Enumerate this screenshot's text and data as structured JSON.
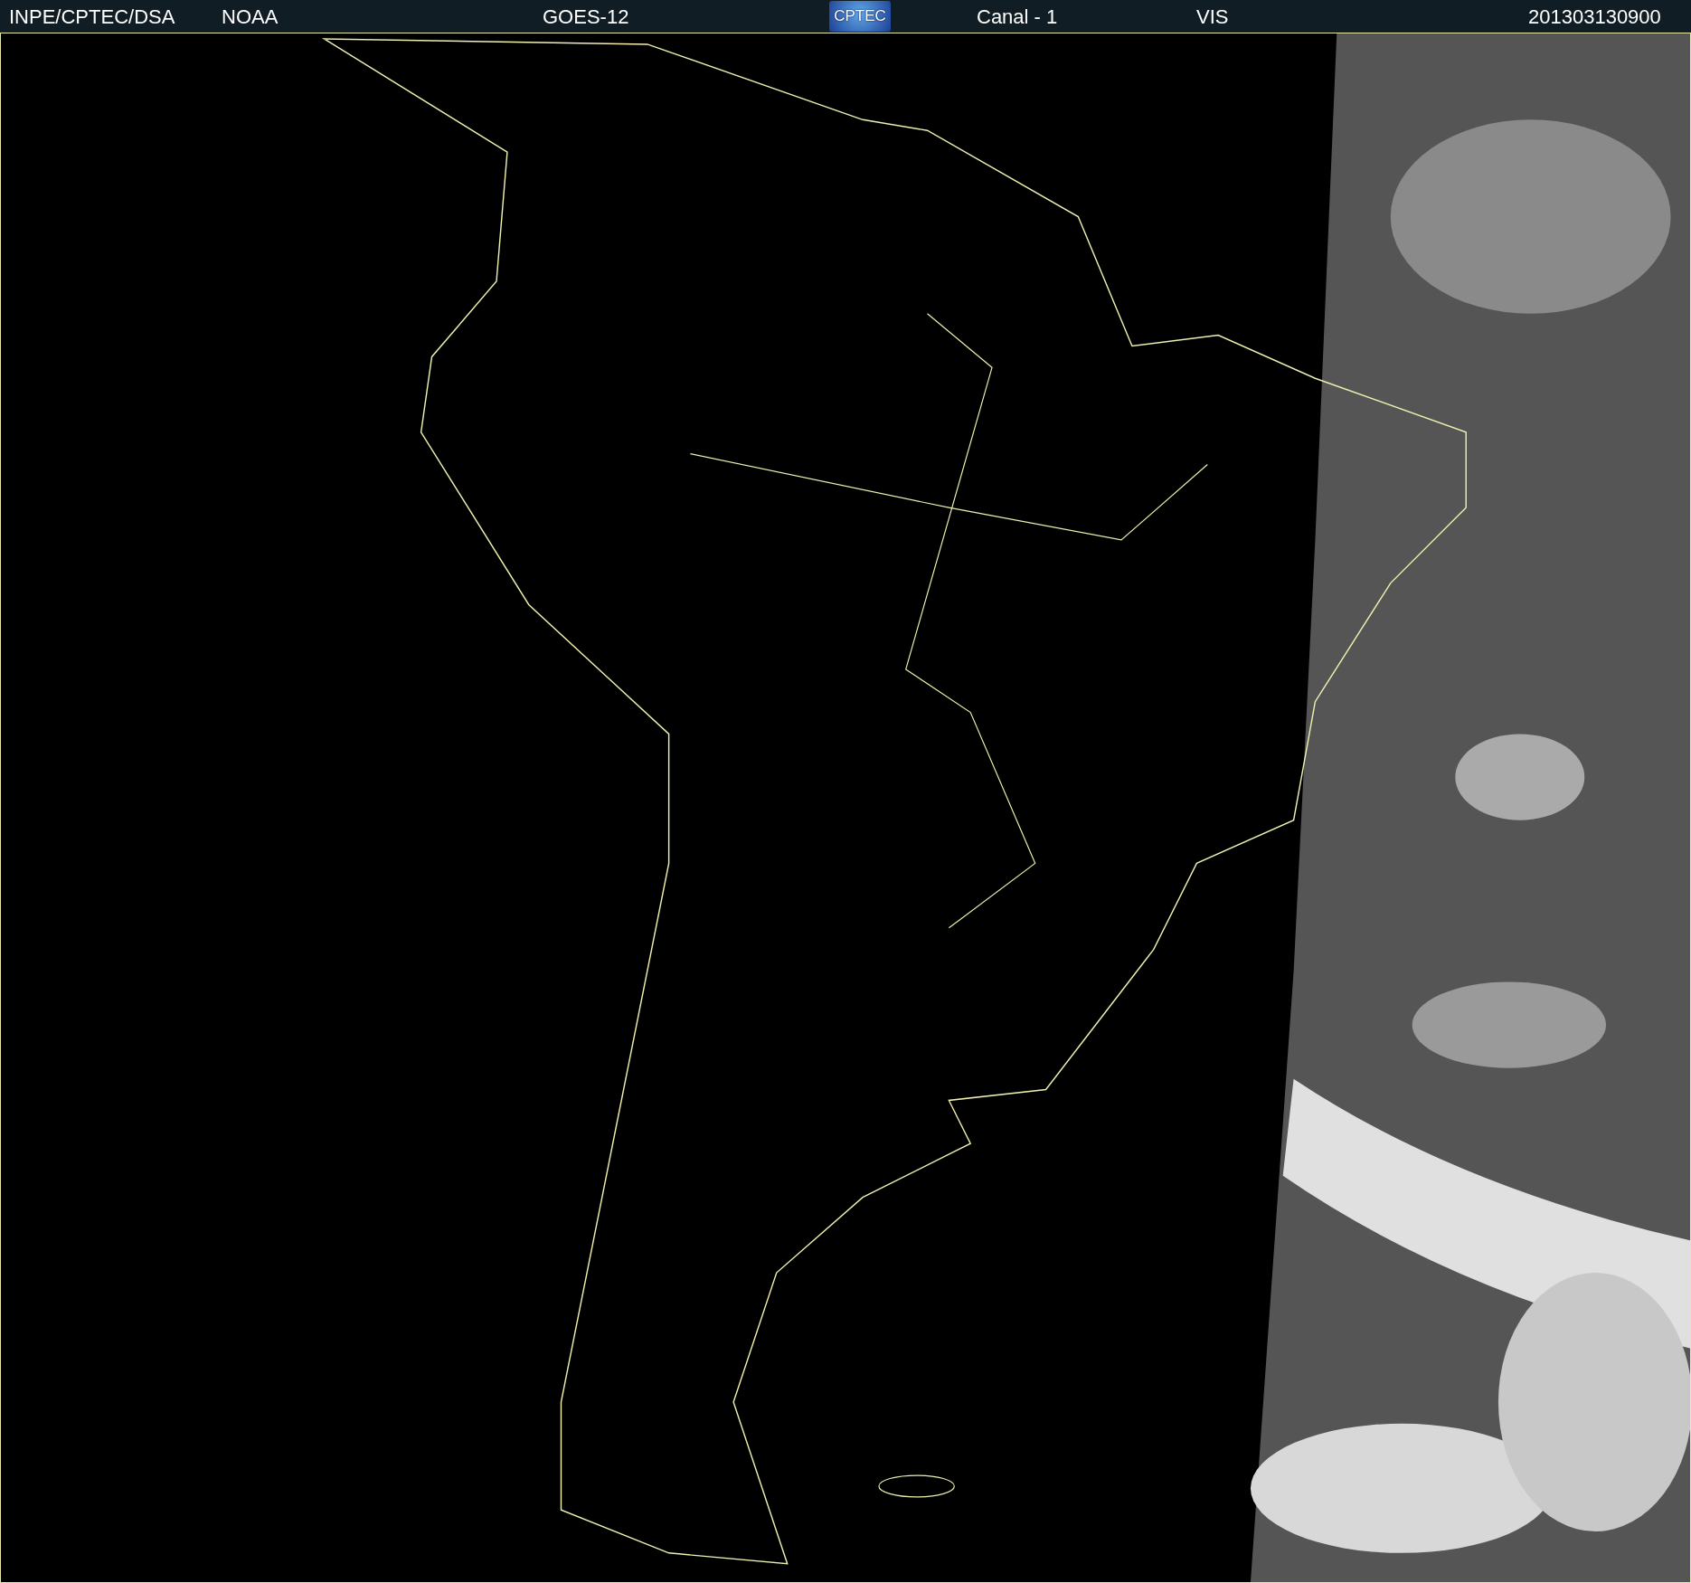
{
  "header": {
    "agency": "INPE/CPTEC/DSA",
    "source": "NOAA",
    "satellite": "GOES-12",
    "logo_text": "CPTEC",
    "channel": "Canal - 1",
    "band": "VIS",
    "timestamp": "201303130900"
  }
}
